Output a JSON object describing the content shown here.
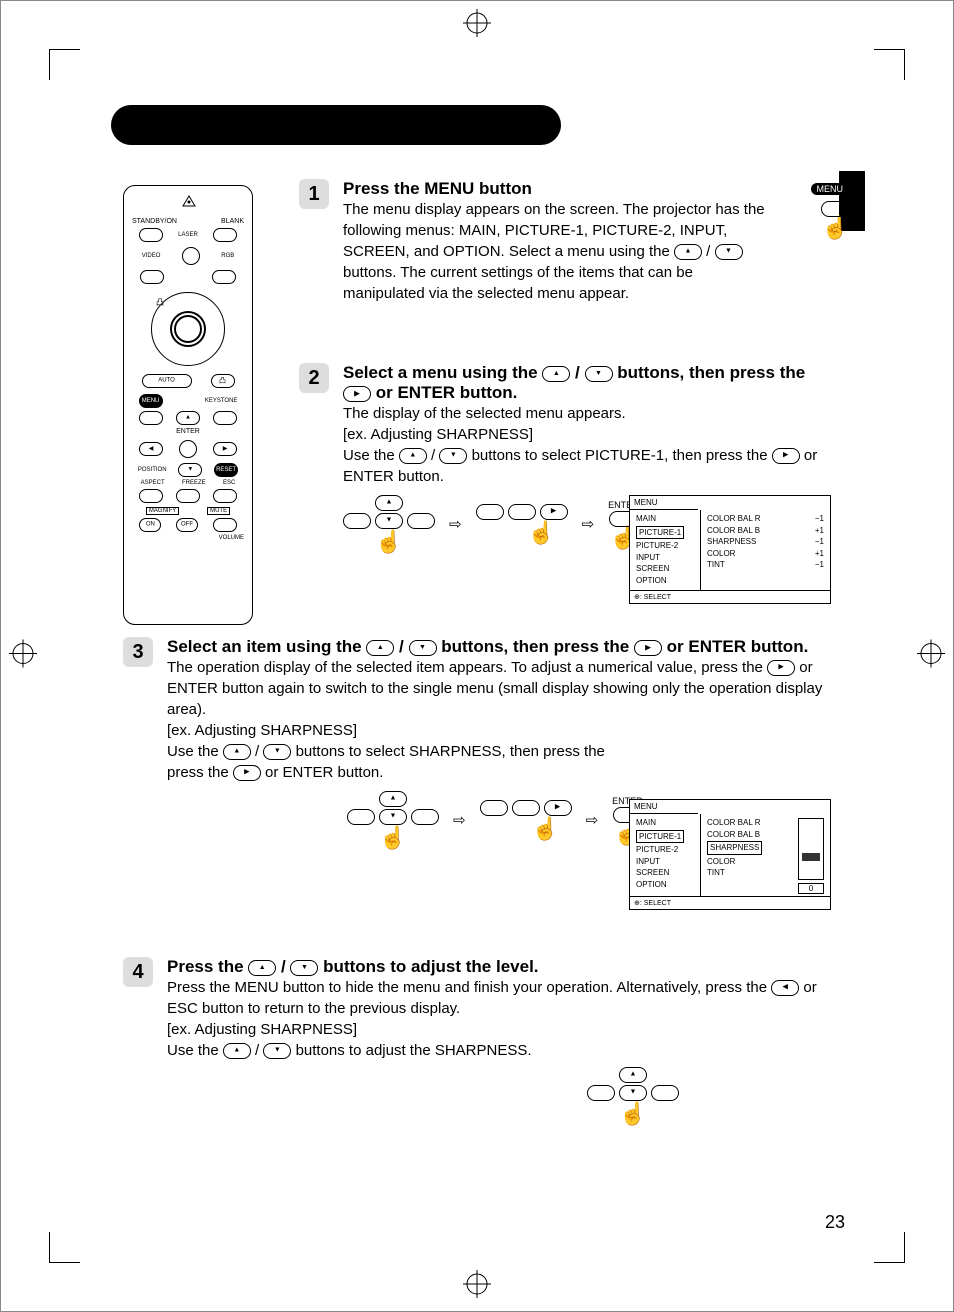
{
  "page_number": "23",
  "remote": {
    "standby_on": "STANDBY/ON",
    "blank": "BLANK",
    "laser": "LASER",
    "video": "VIDEO",
    "rgb": "RGB",
    "auto": "AUTO",
    "menu": "MENU",
    "keystone": "KEYSTONE",
    "enter": "ENTER",
    "position": "POSITION",
    "reset": "RESET",
    "aspect": "ASPECT",
    "freeze": "FREEZE",
    "esc": "ESC",
    "magnify": "MAGNIFY",
    "mute": "MUTE",
    "on": "ON",
    "off": "OFF",
    "volume": "VOLUME"
  },
  "steps": {
    "s1": {
      "num": "1",
      "title": "Press the MENU button",
      "body1": "The menu display appears on the screen. The projector has the following menus: MAIN, PICTURE-1, PICTURE-2, INPUT, SCREEN, and OPTION. Select a menu using the ",
      "body2": " buttons. The current settings of the items that can be manipulated via the selected menu appear.",
      "menu_label": "MENU"
    },
    "s2": {
      "num": "2",
      "title_a": "Select a menu using the ",
      "title_b": " buttons, then press the ",
      "title_c": " or ENTER button.",
      "body1": "The display of the selected menu appears.",
      "ex": "[ex. Adjusting SHARPNESS]",
      "body2a": "Use the ",
      "body2b": " buttons to select PICTURE-1, then press the ",
      "body2c": " or ENTER button.",
      "enter": "ENTER"
    },
    "s3": {
      "num": "3",
      "title_a": "Select an item using the ",
      "title_b": " buttons, then press the ",
      "title_c": " or ENTER button.",
      "body1a": "The operation display of the selected item appears. To adjust a numerical value, press the ",
      "body1b": " or ENTER button again to switch to the single menu (small display showing only the operation display area).",
      "ex": "[ex. Adjusting SHARPNESS]",
      "body2a": "Use the ",
      "body2b": " buttons to select SHARPNESS, then press the ",
      "body2c": " or ENTER button.",
      "enter": "ENTER"
    },
    "s4": {
      "num": "4",
      "title_a": "Press the ",
      "title_b": " buttons to adjust the level.",
      "body1a": "Press the MENU button to hide the menu and finish your operation. Alternatively, press the ",
      "body1b": " or ESC button to return to the previous display.",
      "ex": "[ex. Adjusting SHARPNESS]",
      "body2a": "Use the ",
      "body2b": " buttons to adjust the SHARPNESS."
    }
  },
  "osd1": {
    "title": "MENU",
    "left_items": [
      "MAIN",
      "PICTURE-1",
      "PICTURE-2",
      "INPUT",
      "SCREEN",
      "OPTION"
    ],
    "boxed_index": 1,
    "mid_items": [
      "COLOR BAL R",
      "COLOR BAL B",
      "SHARPNESS",
      "COLOR",
      "TINT"
    ],
    "right_items": [
      "−1",
      "+1",
      "−1",
      "+1",
      "−1"
    ],
    "footer": ": SELECT"
  },
  "osd2": {
    "title": "MENU",
    "left_items": [
      "MAIN",
      "PICTURE-1",
      "PICTURE-2",
      "INPUT",
      "SCREEN",
      "OPTION"
    ],
    "boxed_index": 1,
    "mid_items": [
      "COLOR BAL R",
      "COLOR BAL B",
      "SHARPNESS",
      "COLOR",
      "TINT"
    ],
    "mid_boxed_index": 2,
    "slider_value": "0",
    "footer": ": SELECT"
  }
}
